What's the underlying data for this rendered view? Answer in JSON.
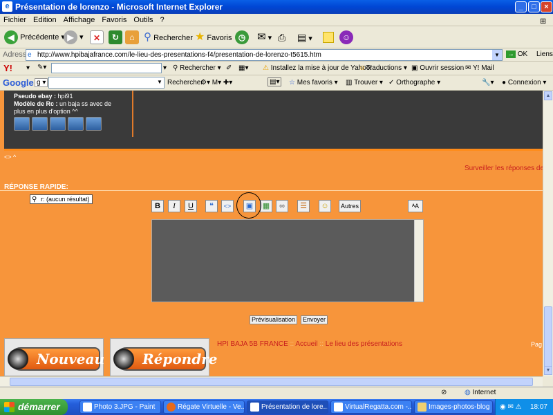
{
  "window": {
    "title": "Présentation de lorenzo - Microsoft Internet Explorer",
    "controls": [
      "_",
      "□",
      "×"
    ]
  },
  "menu": [
    "Fichier",
    "Edition",
    "Affichage",
    "Favoris",
    "Outils",
    "?"
  ],
  "toolbar": {
    "back": "Précédente",
    "search": "Rechercher",
    "favorites": "Favoris"
  },
  "address": {
    "label": "Adresse",
    "url": "http://www.hpibajafrance.com/le-lieu-des-presentations-f4/presentation-de-lorenzo-t5615.htm",
    "go": "OK",
    "links": "Liens"
  },
  "yahoo": {
    "search": "Rechercher",
    "install": "Installez la mise à jour de Yahoo!",
    "translate": "Traductions",
    "session": "Ouvrir session",
    "mail": "Y! Mail"
  },
  "google": {
    "search": "Rechercher",
    "favorites": "Mes favoris",
    "find": "Trouver",
    "spell": "Orthographe",
    "connect": "Connexion"
  },
  "profile": {
    "ebay_label": "Pseudo ebay :",
    "ebay_value": " hpi91",
    "model_label": "Modèle de Rc :",
    "model_value": " un baja ss avec de plus en plus d'option ^^"
  },
  "forum": {
    "arrows": "<> ^",
    "surveiller": "Surveiller les réponses de",
    "reponse_rapide": "RÉPONSE RAPIDE:",
    "tooltip": "r: (aucun résultat)",
    "format_buttons": [
      "B",
      "I",
      "U"
    ],
    "autres": "Autres",
    "preview": "Prévisualisation",
    "send": "Envoyer",
    "nouveau": "Nouveau",
    "repondre": "Répondre",
    "breadcrumb": [
      "HPI BAJA 5B FRANCE",
      "Accueil",
      "Le lieu des présentations"
    ],
    "breadcrumb_sep": "::",
    "pag": "Pag"
  },
  "status": {
    "zone": "Internet"
  },
  "taskbar": {
    "start": "démarrer",
    "tasks": [
      "Photo 3.JPG - Paint",
      "Régate Virtuelle - Ve...",
      "Présentation de lore...",
      "VirtualRegatta.com -...",
      "Images-photos-blog"
    ],
    "clock": "18:07"
  }
}
